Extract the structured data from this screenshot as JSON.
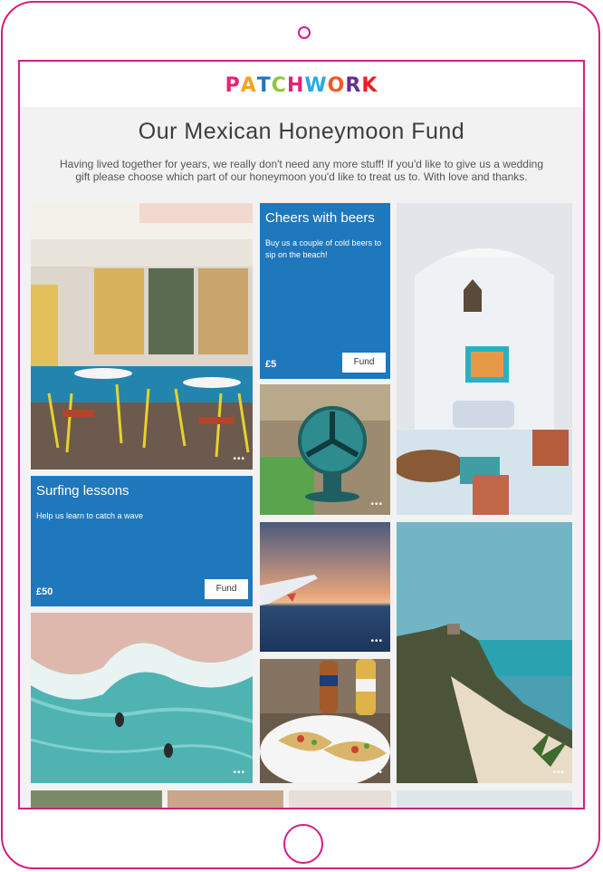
{
  "brand": {
    "letters": [
      "P",
      "A",
      "T",
      "C",
      "H",
      "W",
      "O",
      "R",
      "K"
    ],
    "letter_colors": [
      "#e2237a",
      "#f7a21b",
      "#1f77bc",
      "#8cc63f",
      "#e2237a",
      "#29abe2",
      "#f15a24",
      "#662d91",
      "#ed1c24"
    ]
  },
  "page": {
    "title": "Our Mexican Honeymoon Fund",
    "intro": "Having lived together for years, we really don't need any more stuff! If you'd like to give us a wedding gift please choose which part of our honeymoon you'd like to treat us to. With love and thanks."
  },
  "cards": [
    {
      "title": "Cheers with beers",
      "description": "Buy us a couple of cold beers to sip on the beach!",
      "price": "£5",
      "button": "Fund"
    },
    {
      "title": "Surfing lessons",
      "description": "Help us learn to catch a wave",
      "price": "£50",
      "button": "Fund"
    }
  ],
  "gallery": {
    "more_indicator": "•••"
  },
  "colors": {
    "frame": "#d11f85",
    "card_blue": "#1f77bc",
    "background": "#f3f2f2"
  }
}
